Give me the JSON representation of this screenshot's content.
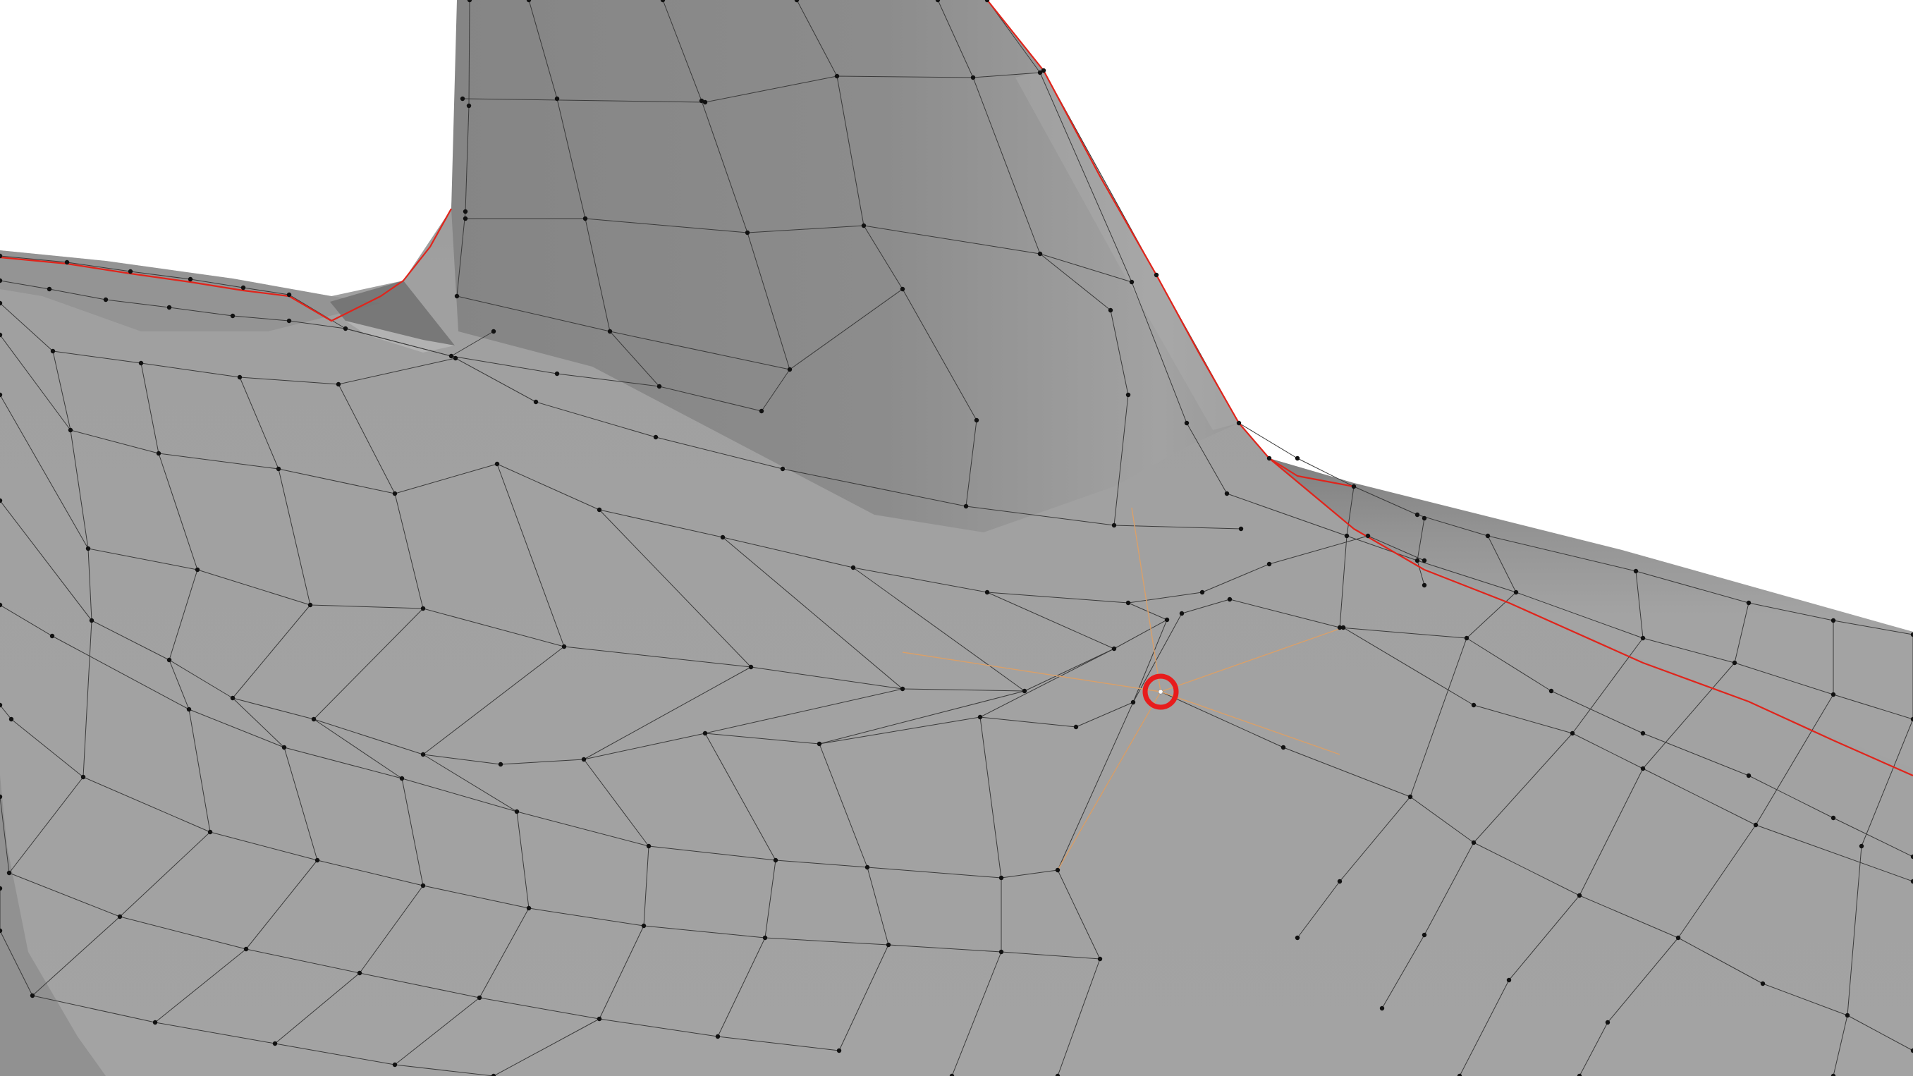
{
  "viewport": {
    "background": "#ffffff",
    "mesh_color": "#a1a1a1",
    "mesh_shadow_color": "#7e7e7e",
    "wire_color": "#3a3a3a",
    "seam_color": "#e0241b",
    "vertex_color": "#111111",
    "selected_vertex_color": "#ffffff",
    "selected_edge_color": "#d9a06a",
    "highlight_ring_color": "#e81c1c"
  },
  "icons": {
    "selection_marker": "circle-ring-icon"
  }
}
